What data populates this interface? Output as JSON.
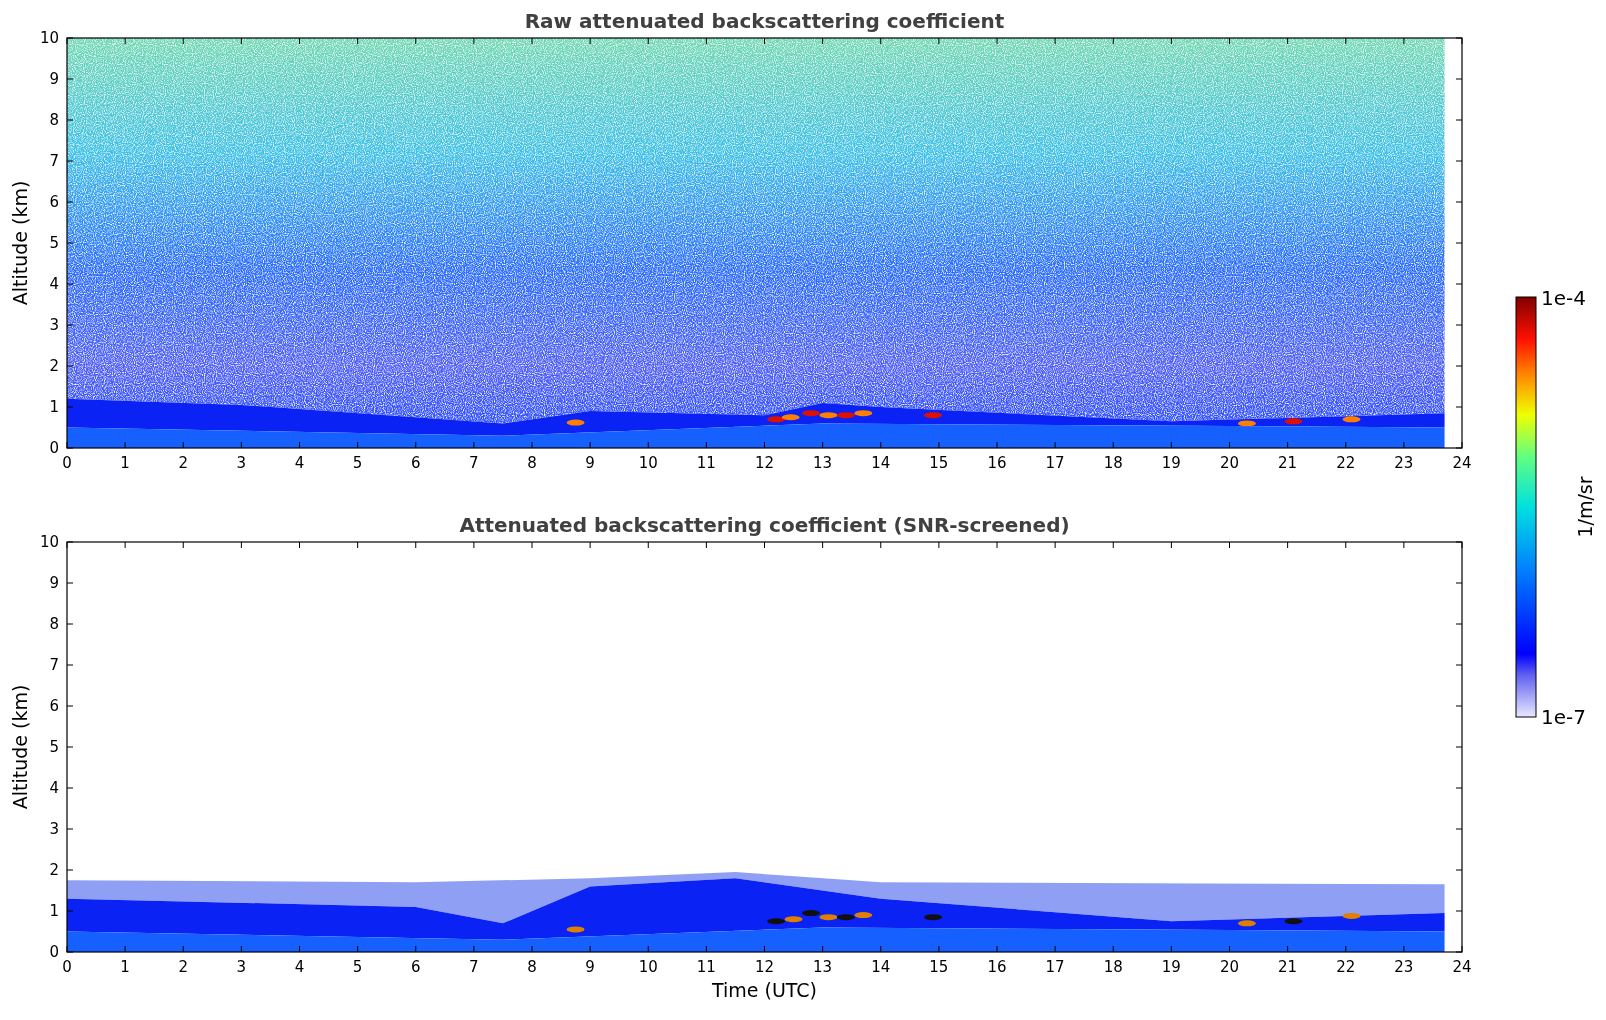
{
  "panels": [
    {
      "title": "Raw attenuated backscattering coefficient",
      "kind": "raw",
      "ylabel": "Altitude (km)",
      "yticks": [
        "10",
        "9",
        "8",
        "7",
        "6",
        "5",
        "4",
        "3",
        "2",
        "1",
        "0"
      ],
      "xticks": [
        "0",
        "1",
        "2",
        "3",
        "4",
        "5",
        "6",
        "7",
        "8",
        "9",
        "10",
        "11",
        "12",
        "13",
        "14",
        "15",
        "16",
        "17",
        "18",
        "19",
        "20",
        "21",
        "22",
        "23",
        "24"
      ]
    },
    {
      "title": "Attenuated backscattering coefficient (SNR-screened)",
      "kind": "screened",
      "ylabel": "Altitude (km)",
      "yticks": [
        "10",
        "9",
        "8",
        "7",
        "6",
        "5",
        "4",
        "3",
        "2",
        "1",
        "0"
      ],
      "xticks": [
        "0",
        "1",
        "2",
        "3",
        "4",
        "5",
        "6",
        "7",
        "8",
        "9",
        "10",
        "11",
        "12",
        "13",
        "14",
        "15",
        "16",
        "17",
        "18",
        "19",
        "20",
        "21",
        "22",
        "23",
        "24"
      ],
      "xlabel": "Time (UTC)"
    }
  ],
  "colorbar": {
    "label": "1/m/sr",
    "max_label": "1e-4",
    "min_label": "1e-7"
  }
}
